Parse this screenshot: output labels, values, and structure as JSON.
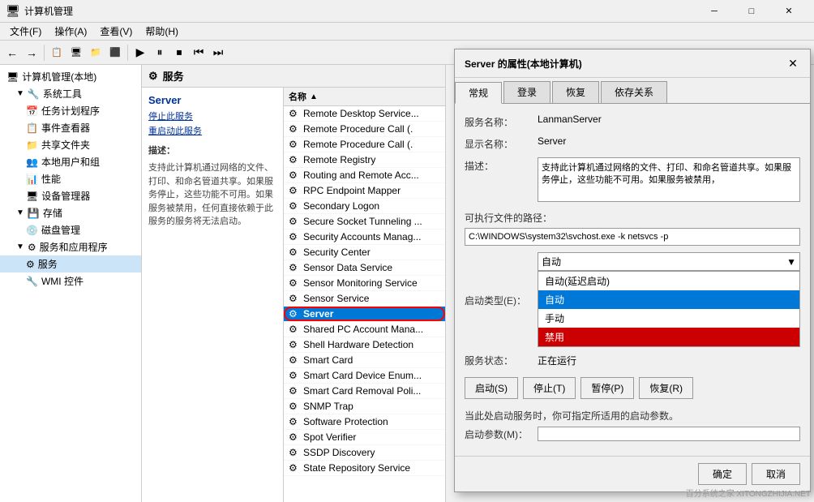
{
  "window": {
    "title": "计算机管理",
    "icon": "🖥"
  },
  "menubar": {
    "items": [
      "文件(F)",
      "操作(A)",
      "查看(V)",
      "帮助(H)"
    ]
  },
  "toolbar": {
    "buttons": [
      "←",
      "→",
      "⬆",
      "📋",
      "🖥",
      "📁",
      "🔲",
      "▶",
      "⏸",
      "⏹",
      "⏮",
      "⏭"
    ]
  },
  "nav": {
    "items": [
      {
        "label": "计算机管理(本地)",
        "level": 0,
        "expanded": true,
        "icon": "🖥"
      },
      {
        "label": "系统工具",
        "level": 1,
        "expanded": true,
        "icon": "🔧"
      },
      {
        "label": "任务计划程序",
        "level": 2,
        "icon": "📅"
      },
      {
        "label": "事件查看器",
        "level": 2,
        "icon": "📋"
      },
      {
        "label": "共享文件夹",
        "level": 2,
        "icon": "📁"
      },
      {
        "label": "本地用户和组",
        "level": 2,
        "icon": "👥"
      },
      {
        "label": "性能",
        "level": 2,
        "icon": "📊"
      },
      {
        "label": "设备管理器",
        "level": 2,
        "icon": "🖥"
      },
      {
        "label": "存储",
        "level": 1,
        "expanded": true,
        "icon": "💾"
      },
      {
        "label": "磁盘管理",
        "level": 2,
        "icon": "💿"
      },
      {
        "label": "服务和应用程序",
        "level": 1,
        "expanded": true,
        "icon": "⚙"
      },
      {
        "label": "服务",
        "level": 2,
        "icon": "⚙",
        "selected": true
      },
      {
        "label": "WMI 控件",
        "level": 2,
        "icon": "🔧"
      }
    ]
  },
  "services_panel": {
    "header": "服务",
    "selected_service": "Server",
    "actions": [
      "停止此服务",
      "重启动此服务"
    ],
    "description_label": "描述：",
    "description": "支持此计算机通过网络的文件、打印、和命名管道共享。如果服务停止，这些功能不可用。如果服务被禁用，任何直接依赖于此服务的服务将无法启动。",
    "column_header": "名称",
    "services": [
      {
        "name": "Remote Desktop Service...",
        "selected": false
      },
      {
        "name": "Remote Procedure Call (.",
        "selected": false
      },
      {
        "name": "Remote Procedure Call (.",
        "selected": false
      },
      {
        "name": "Remote Registry",
        "selected": false
      },
      {
        "name": "Routing and Remote Acc...",
        "selected": false
      },
      {
        "name": "RPC Endpoint Mapper",
        "selected": false
      },
      {
        "name": "Secondary Logon",
        "selected": false
      },
      {
        "name": "Secure Socket Tunneling ...",
        "selected": false
      },
      {
        "name": "Security Accounts Manag...",
        "selected": false
      },
      {
        "name": "Security Center",
        "selected": false
      },
      {
        "name": "Sensor Data Service",
        "selected": false
      },
      {
        "name": "Sensor Monitoring Service",
        "selected": false
      },
      {
        "name": "Sensor Service",
        "selected": false
      },
      {
        "name": "Server",
        "selected": true,
        "highlighted": true
      },
      {
        "name": "Shared PC Account Mana...",
        "selected": false
      },
      {
        "name": "Shell Hardware Detection",
        "selected": false
      },
      {
        "name": "Smart Card",
        "selected": false
      },
      {
        "name": "Smart Card Device Enum...",
        "selected": false
      },
      {
        "name": "Smart Card Removal Poli...",
        "selected": false
      },
      {
        "name": "SNMP Trap",
        "selected": false
      },
      {
        "name": "Software Protection",
        "selected": false
      },
      {
        "name": "Spot Verifier",
        "selected": false
      },
      {
        "name": "SSDP Discovery",
        "selected": false
      },
      {
        "name": "State Repository Service",
        "selected": false
      }
    ]
  },
  "dialog": {
    "title": "Server 的属性(本地计算机)",
    "close_btn": "✕",
    "tabs": [
      "常规",
      "登录",
      "恢复",
      "依存关系"
    ],
    "active_tab": "常规",
    "fields": {
      "service_name_label": "服务名称：",
      "service_name_value": "LanmanServer",
      "display_name_label": "显示名称：",
      "display_name_value": "Server",
      "desc_label": "描述：",
      "desc_value": "支持此计算机通过网络的文件、打印、和命名管道共享。如果服务停止，这些功能不可用。如果服务被禁用，",
      "path_label": "可执行文件的路径：",
      "path_value": "C:\\WINDOWS\\system32\\svchost.exe -k netsvcs -p",
      "startup_label": "启动类型(E)：",
      "startup_value": "自动",
      "startup_options": [
        {
          "label": "自动(延迟启动)",
          "active": false
        },
        {
          "label": "自动",
          "active": true,
          "color": "blue"
        },
        {
          "label": "手动",
          "active": false
        },
        {
          "label": "禁用",
          "active": true,
          "color": "red"
        }
      ],
      "status_label": "服务状态：",
      "status_value": "正在运行",
      "buttons": {
        "start": "启动(S)",
        "stop": "停止(T)",
        "pause": "暂停(P)",
        "resume": "恢复(R)"
      },
      "start_param_label": "当此处启动服务时，你可指定所适用的启动参数。",
      "start_param_input_label": "启动参数(M)："
    },
    "footer": {
      "confirm": "确定",
      "cancel": "取消"
    }
  },
  "watermark": "百分系统之家 XITONGZHIJIA.NET"
}
